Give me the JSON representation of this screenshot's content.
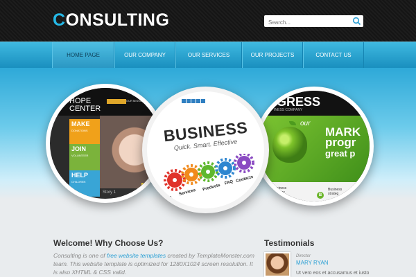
{
  "header": {
    "logo_first": "C",
    "logo_rest": "ONSULTING",
    "search_placeholder": "Search..."
  },
  "nav": {
    "items": [
      {
        "label": "HOME PAGE",
        "active": true
      },
      {
        "label": "OUR COMPANY",
        "active": false
      },
      {
        "label": "OUR SERVICES",
        "active": false
      },
      {
        "label": "OUR PROJECTS",
        "active": false
      },
      {
        "label": "CONTACT US",
        "active": false
      }
    ]
  },
  "slides": {
    "left": {
      "title_line1": "HOPE",
      "title_line2": "CENTER",
      "tab1": "",
      "tab2": "OUR MISSION",
      "blocks": [
        {
          "big": "MAKE",
          "small": "DONATIONS"
        },
        {
          "big": "JOIN",
          "small": "VOLUNTEER"
        },
        {
          "big": "HELP",
          "small": "CHILDREN"
        }
      ],
      "story": "Story 1",
      "badge": "T"
    },
    "center": {
      "title": "BUSINESS",
      "tagline": "Quick. Smart. Effective",
      "gear_labels": [
        "News",
        "Services",
        "Products",
        "FAQ",
        "Contacts"
      ]
    },
    "right": {
      "title": "OGRESS",
      "subtitle": "INESS COMPANY",
      "our": "our",
      "headline_1": "MARK",
      "headline_2": "progr",
      "headline_3": "great p",
      "bottom_left": "Business\nstrategy",
      "badge": "B",
      "bottom_right": "Business\nstrateg"
    }
  },
  "welcome": {
    "title": "Welcome! Why Choose Us?",
    "text_before": "Consulting is one of ",
    "link": "free website templates",
    "text_after": " created by TemplateMonster.com team. This website template is optimized for 1280X1024 screen resolution. It is also XHTML & CSS valid."
  },
  "testimonials": {
    "title": "Testimonials",
    "role": "Director",
    "name": "MARY RYAN",
    "quote": "Ut vero eos et accusamus et iusto"
  },
  "colors": {
    "accent": "#25b8e6",
    "nav_top": "#3fb9e0",
    "nav_bottom": "#1a8fbf",
    "link": "#2a9fd4"
  }
}
